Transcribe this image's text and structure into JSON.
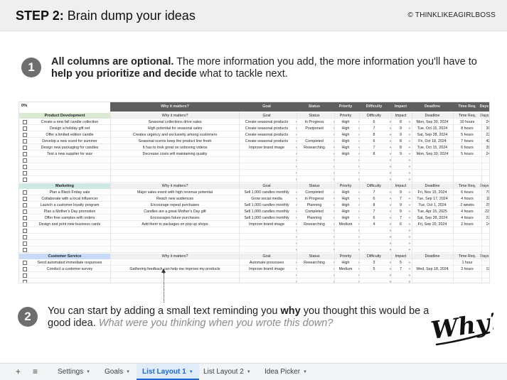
{
  "header": {
    "step": "STEP 2:",
    "title": "Brain dump your ideas",
    "brand": "© THINKLIKEAGIRLBOSS"
  },
  "callout1": {
    "number": "1",
    "part1": "All columns are optional.",
    "part2": " The more information you add, the more information you'll have to ",
    "part3": "help you prioritize and decide",
    "part4": " what to tackle next."
  },
  "callout2": {
    "number": "2",
    "part1": "You can start by adding a small text reminding you ",
    "part2": "why",
    "part3": " you thought this would be a good idea. ",
    "part4": "What were you thinking when you wrote this down?"
  },
  "doodle": {
    "text": "Why?"
  },
  "sheet": {
    "corner_label": "0%",
    "columns": [
      "Why it matters?",
      "Goal",
      "Status",
      "Priority",
      "Difficulty",
      "Impact",
      "Deadline",
      "Time Req.",
      "Days Left"
    ],
    "sections": [
      {
        "name": "Product Development",
        "color": "#d9ead3",
        "rows": [
          [
            "Create a new fall candle collection",
            "Seasonal collections drive sales",
            "Create seasonal products",
            "In Progress",
            "High",
            "6",
            "8",
            "Mon, Sep 30, 2024",
            "10 hours",
            "24"
          ],
          [
            "Design a holiday gift set",
            "High potential for seasonal sales",
            "Create seasonal products",
            "Postponed",
            "High",
            "7",
            "9",
            "Tue, Oct 15, 2024",
            "8 hours",
            "39"
          ],
          [
            "Offer a limited edition candle",
            "Creates urgency and exclusivity among customers",
            "Create seasonal products",
            "",
            "High",
            "8",
            "9",
            "Sat, Sep 28, 2024",
            "5 hours",
            "22"
          ],
          [
            "Develop a new scent for summer",
            "Seasonal scents keep the product line fresh",
            "Create seasonal products",
            "Completed",
            "High",
            "6",
            "8",
            "Fri, Oct 18, 2024",
            "7 hours",
            "42"
          ],
          [
            "Design new packaging for candles",
            "It has to look great on unboxing videos",
            "Improve brand image",
            "Researching",
            "High",
            "7",
            "8",
            "Tue, Oct 15, 2024",
            "6 hours",
            "39"
          ],
          [
            "Test a new supplier for wax",
            "Decrease costs will maintaining quality",
            "",
            "",
            "High",
            "8",
            "9",
            "Mon, Sep 30, 2024",
            "5 hours",
            "24"
          ],
          [
            "",
            "",
            "",
            "",
            "",
            "",
            "",
            "",
            "",
            ""
          ],
          [
            "",
            "",
            "",
            "",
            "",
            "",
            "",
            "",
            "",
            ""
          ],
          [
            "",
            "",
            "",
            "",
            "",
            "",
            "",
            "",
            "",
            ""
          ],
          [
            "",
            "",
            "",
            "",
            "",
            "",
            "",
            "",
            "",
            ""
          ]
        ]
      },
      {
        "name": "Marketing",
        "color": "#d0e8e4",
        "rows": [
          [
            "Plan a Black Friday sale",
            "Major sales event with high revenue potential",
            "Sell 1,000 candles monthly",
            "Completed",
            "High",
            "7",
            "9",
            "Fri, Nov 15, 2024",
            "6 hours",
            "70"
          ],
          [
            "Collaborate with a local influencer",
            "Reach new audiences",
            "Grow social media",
            "In Progress",
            "High",
            "6",
            "7",
            "Tue, Sep 17, 2024",
            "4 hours",
            "11"
          ],
          [
            "Launch a customer loyalty program",
            "Encourage repeat purchases",
            "Sell 1,000 candles monthly",
            "Planning",
            "High",
            "8",
            "9",
            "Tue, Oct 1, 2024",
            "2 weeks",
            "25"
          ],
          [
            "Plan a Mother's Day promotion",
            "Candles are a great Mother's Day gift",
            "Sell 1,000 candles monthly",
            "Completed",
            "High",
            "7",
            "9",
            "Tue, Apr 15, 2025",
            "4 hours",
            "221"
          ],
          [
            "Offer free samples with orders",
            "Encourages future purchases",
            "Sell 1,000 candles monthly",
            "Planning",
            "High",
            "6",
            "7",
            "Sat, Sep 28, 2024",
            "4 hours",
            "22"
          ],
          [
            "Design and print new business cards",
            "Add them to packages on pop up shops",
            "Improve brand image",
            "Researching",
            "Medium",
            "4",
            "6",
            "Fri, Sep 20, 2024",
            "2 hours",
            "14"
          ],
          [
            "",
            "",
            "",
            "",
            "",
            "",
            "",
            "",
            "",
            ""
          ],
          [
            "",
            "",
            "",
            "",
            "",
            "",
            "",
            "",
            "",
            ""
          ],
          [
            "",
            "",
            "",
            "",
            "",
            "",
            "",
            "",
            "",
            ""
          ],
          [
            "",
            "",
            "",
            "",
            "",
            "",
            "",
            "",
            "",
            ""
          ]
        ]
      },
      {
        "name": "Customer Service",
        "color": "#c9daf8",
        "rows": [
          [
            "Send automated immediate responses",
            "",
            "Automate processes",
            "Researching",
            "High",
            "3",
            "5",
            "",
            "1 hour",
            ""
          ],
          [
            "Conduct a customer survey",
            "Gathering feedback can help me improve my products",
            "Improve brand image",
            "",
            "Medium",
            "5",
            "7",
            "Wed, Sep 18, 2024",
            "3 hours",
            "12"
          ],
          [
            "",
            "",
            "",
            "",
            "",
            "",
            "",
            "",
            "",
            ""
          ],
          [
            "",
            "",
            "",
            "",
            "",
            "",
            "",
            "",
            "",
            ""
          ],
          [
            "",
            "",
            "",
            "",
            "",
            "",
            "",
            "",
            "",
            ""
          ],
          [
            "",
            "",
            "",
            "",
            "",
            "",
            "",
            "",
            "",
            ""
          ],
          [
            "",
            "",
            "",
            "",
            "",
            "",
            "",
            "",
            "",
            ""
          ]
        ]
      }
    ]
  },
  "tabs": {
    "add_icon": "plus-icon",
    "menu_icon": "menu-icon",
    "items": [
      {
        "label": "Settings",
        "active": false
      },
      {
        "label": "Goals",
        "active": false
      },
      {
        "label": "List Layout 1",
        "active": true
      },
      {
        "label": "List Layout 2",
        "active": false
      },
      {
        "label": "Idea Picker",
        "active": false
      }
    ]
  }
}
